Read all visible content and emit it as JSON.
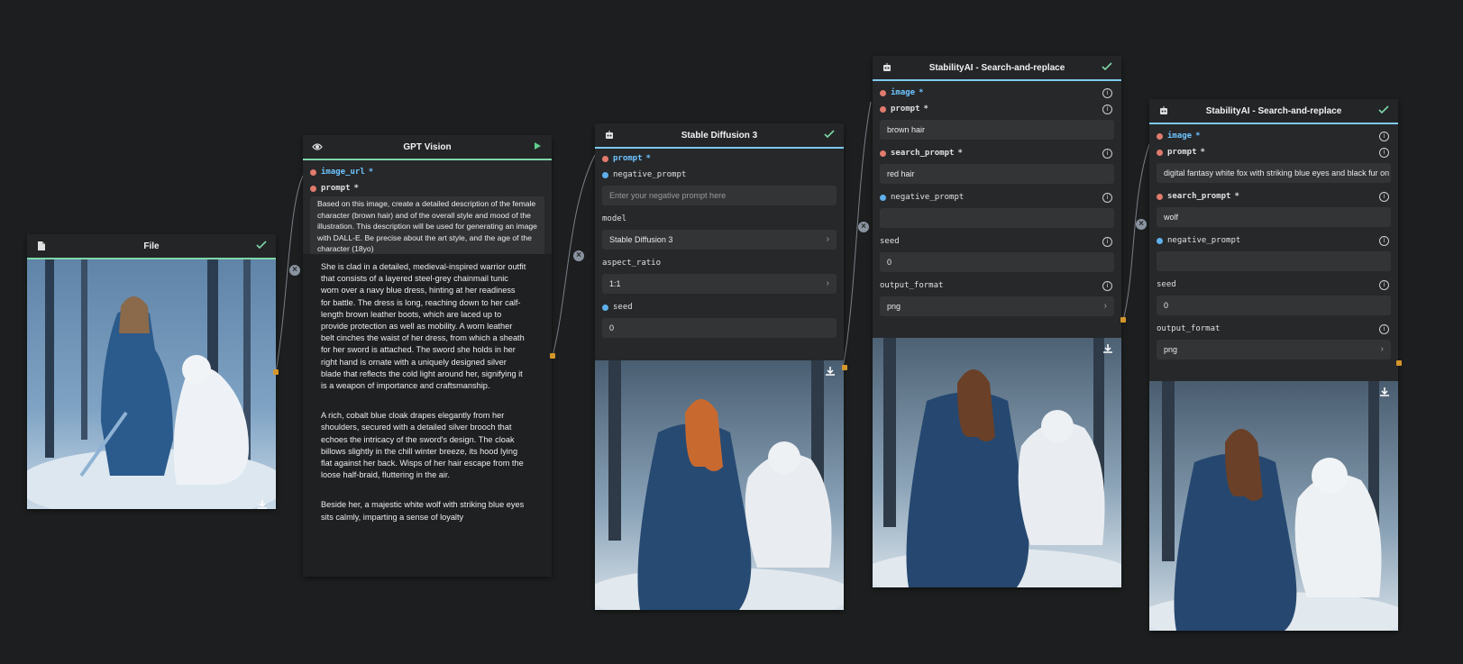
{
  "nodes": {
    "file": {
      "title": "File"
    },
    "gpt": {
      "title": "GPT Vision",
      "fields": {
        "image_url": "image_url",
        "prompt": "prompt",
        "prompt_value": "Based on this image, create a detailed description of the female character (brown hair) and of the overall style and mood of the illustration. This description will be used for generating an image with DALL-E. Be precise about the art style, and the age of the character (18yo)"
      },
      "output_paragraphs": [
        "She is clad in a detailed, medieval-inspired warrior outfit that consists of a layered steel-grey chainmail tunic worn over a navy blue dress, hinting at her readiness for battle. The dress is long, reaching down to her calf-length brown leather boots, which are laced up to provide protection as well as mobility. A worn leather belt cinches the waist of her dress, from which a sheath for her sword is attached. The sword she holds in her right hand is ornate with a uniquely designed silver blade that reflects the cold light around her, signifying it is a weapon of importance and craftsmanship.",
        "A rich, cobalt blue cloak drapes elegantly from her shoulders, secured with a detailed silver brooch that echoes the intricacy of the sword's design. The cloak billows slightly in the chill winter breeze, its hood lying flat against her back. Wisps of her hair escape from the loose half-braid, fluttering in the air.",
        "Beside her, a majestic white wolf with striking blue eyes sits calmly, imparting a sense of loyalty"
      ]
    },
    "sd3": {
      "title": "Stable Diffusion 3",
      "prompt_label": "prompt",
      "negative_label": "negative_prompt",
      "negative_placeholder": "Enter your negative prompt here",
      "model_label": "model",
      "model_value": "Stable Diffusion 3",
      "aspect_label": "aspect_ratio",
      "aspect_value": "1:1",
      "seed_label": "seed",
      "seed_value": "0"
    },
    "sr1": {
      "title": "StabilityAI - Search-and-replace",
      "image_label": "image",
      "prompt_label": "prompt",
      "prompt_value": "brown hair",
      "search_label": "search_prompt",
      "search_value": "red hair",
      "negative_label": "negative_prompt",
      "negative_value": "",
      "seed_label": "seed",
      "seed_value": "0",
      "format_label": "output_format",
      "format_value": "png"
    },
    "sr2": {
      "title": "StabilityAI - Search-and-replace",
      "image_label": "image",
      "prompt_label": "prompt",
      "prompt_value": "digital fantasy white fox with striking blue eyes and black fur on",
      "search_label": "search_prompt",
      "search_value": "wolf",
      "negative_label": "negative_prompt",
      "negative_value": "",
      "seed_label": "seed",
      "seed_value": "0",
      "format_label": "output_format",
      "format_value": "png"
    }
  },
  "symbols": {
    "required": "*",
    "info": "i",
    "chevron": "›",
    "disconnect": "×"
  },
  "colors": {
    "canvas": "#1c1e1f",
    "node": "#26282a",
    "header_accent_green": "#7fd6a8",
    "header_accent_blue": "#7fc9f0",
    "port_orange": "#d4962a",
    "input_blue": "#6ec4ff",
    "dot_red": "#e07b6d",
    "dot_blue": "#5fb0ea"
  },
  "icons": [
    "file-icon",
    "eye-icon",
    "play-icon",
    "robot-icon",
    "check-icon",
    "info-icon",
    "download-icon",
    "chevron-right-icon",
    "disconnect-icon"
  ]
}
